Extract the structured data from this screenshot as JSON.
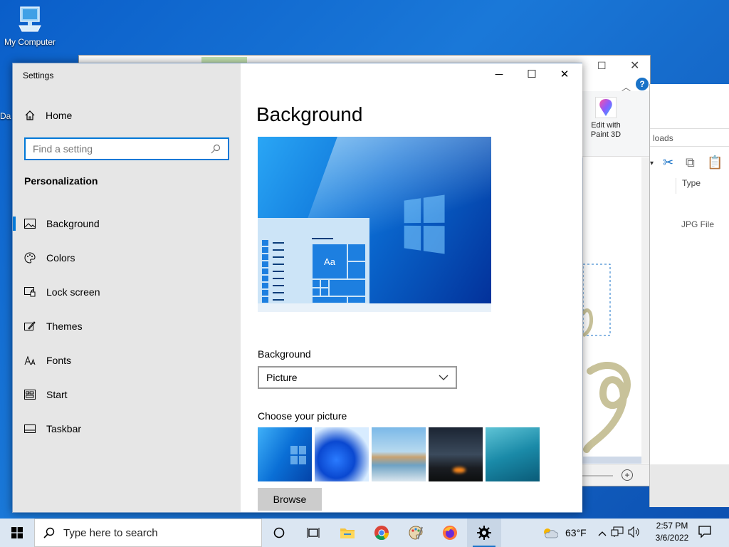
{
  "desktop": {
    "icon_label": "My Computer",
    "partial_icon_label": "Da"
  },
  "paint": {
    "edit_paint3d_line1": "Edit with",
    "edit_paint3d_line2": "Paint 3D",
    "help": "?"
  },
  "explorer": {
    "address_partial": "loads",
    "column_type": "Type",
    "file_type": "JPG File"
  },
  "settings": {
    "window_title": "Settings",
    "home_label": "Home",
    "search_placeholder": "Find a setting",
    "section_title": "Personalization",
    "nav": [
      {
        "label": "Background",
        "icon": "picture-icon",
        "active": true
      },
      {
        "label": "Colors",
        "icon": "palette-icon"
      },
      {
        "label": "Lock screen",
        "icon": "lock-screen-icon"
      },
      {
        "label": "Themes",
        "icon": "brush-icon"
      },
      {
        "label": "Fonts",
        "icon": "font-icon"
      },
      {
        "label": "Start",
        "icon": "start-icon"
      },
      {
        "label": "Taskbar",
        "icon": "taskbar-icon"
      }
    ],
    "page_title": "Background",
    "preview_tile_text": "Aa",
    "background_label": "Background",
    "background_value": "Picture",
    "choose_picture_label": "Choose your picture",
    "browse_label": "Browse"
  },
  "taskbar": {
    "search_placeholder": "Type here to search",
    "weather_temp": "63°F",
    "time": "2:57 PM",
    "date": "3/6/2022",
    "accent_color": "#0078d7"
  }
}
